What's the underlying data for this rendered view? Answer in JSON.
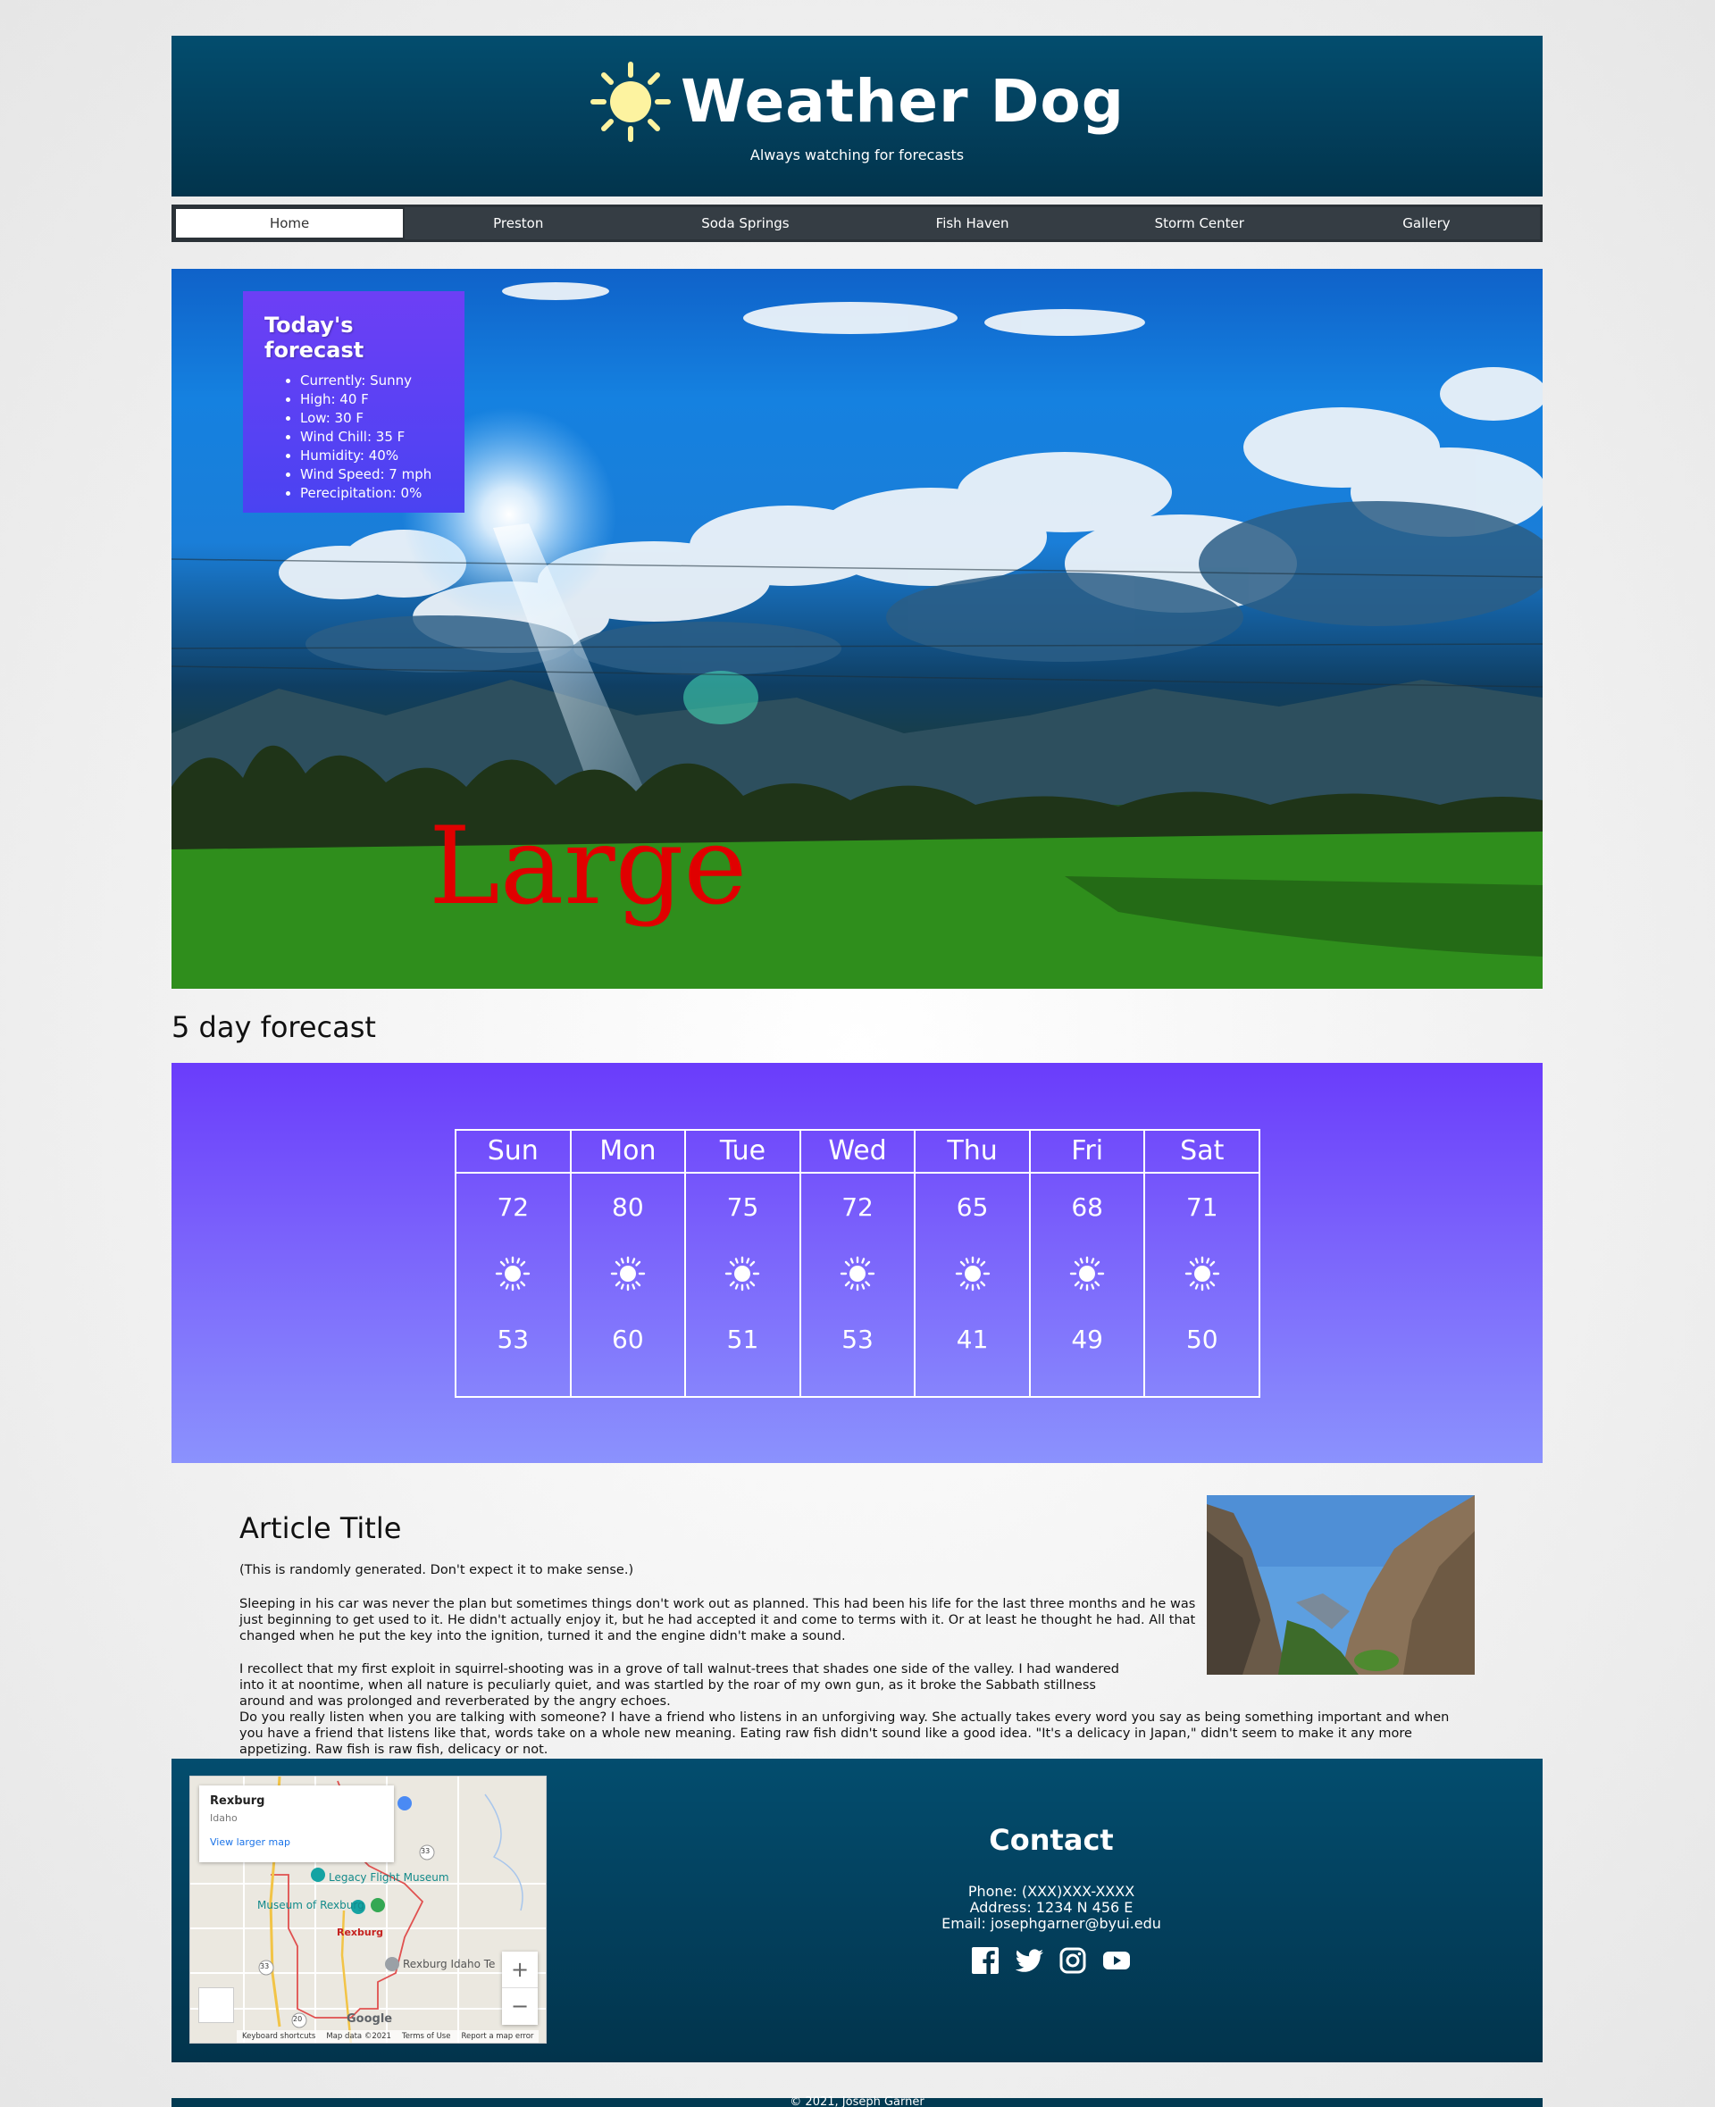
{
  "header": {
    "title": "Weather Dog",
    "tagline": "Always watching for forecasts",
    "logo_icon": "sun-icon"
  },
  "nav": {
    "items": [
      {
        "label": "Home",
        "active": true
      },
      {
        "label": "Preston",
        "active": false
      },
      {
        "label": "Soda Springs",
        "active": false
      },
      {
        "label": "Fish Haven",
        "active": false
      },
      {
        "label": "Storm Center",
        "active": false
      },
      {
        "label": "Gallery",
        "active": false
      }
    ]
  },
  "hero": {
    "overlay_text": "Large",
    "forecast": {
      "title": "Today's forecast",
      "items": [
        "Currently: Sunny",
        "High: 40 F",
        "Low: 30 F",
        "Wind Chill: 35 F",
        "Humidity: 40%",
        "Wind Speed: 7 mph",
        "Perecipitation: 0%"
      ]
    }
  },
  "five_day": {
    "title": "5 day forecast",
    "days": [
      {
        "day": "Sun",
        "high": "72",
        "low": "53",
        "icon": "sun-icon"
      },
      {
        "day": "Mon",
        "high": "80",
        "low": "60",
        "icon": "sun-icon"
      },
      {
        "day": "Tue",
        "high": "75",
        "low": "51",
        "icon": "sun-icon"
      },
      {
        "day": "Wed",
        "high": "72",
        "low": "53",
        "icon": "sun-icon"
      },
      {
        "day": "Thu",
        "high": "65",
        "low": "41",
        "icon": "sun-icon"
      },
      {
        "day": "Fri",
        "high": "68",
        "low": "49",
        "icon": "sun-icon"
      },
      {
        "day": "Sat",
        "high": "71",
        "low": "50",
        "icon": "sun-icon"
      }
    ]
  },
  "article": {
    "title": "Article Title",
    "intro": "(This is randomly generated. Don't expect it to make sense.)",
    "p1": "Sleeping in his car was never the plan but sometimes things don't work out as planned. This had been his life for the last three months and he was just beginning to get used to it. He didn't actually enjoy it, but he had accepted it and come to terms with it. Or at least he thought he had. All that changed when he put the key into the ignition, turned it and the engine didn't make a sound.",
    "p2a": "I recollect that my first exploit in squirrel-shooting was in a grove of tall walnut-trees that shades one side of the valley. I had wandered into it at noontime, when all nature is peculiarly quiet, and was startled by the roar of my own gun, as it broke the Sabbath stillness around and was prolonged and reverberated by the angry echoes.",
    "p2b": "Do you really listen when you are talking with someone? I have a friend who listens in an unforgiving way. She actually takes every word you say as being something important and when you have a friend that listens like that, words take on a whole new meaning. Eating raw fish didn't sound like a good idea. \"It's a delicacy in Japan,\" didn't seem to make it any more appetizing. Raw fish is raw fish, delicacy or not."
  },
  "map": {
    "place": "Rexburg",
    "region": "Idaho",
    "link": "View larger map",
    "labels": [
      "Legacy Flight Museum",
      "Museum of Rexburg",
      "Rexburg",
      "Rexburg Idaho Te"
    ],
    "route_shields": [
      "33",
      "33",
      "20"
    ],
    "zoom_in": "+",
    "zoom_out": "−",
    "brand": "Google",
    "attribution": [
      "Keyboard shortcuts",
      "Map data ©2021",
      "Terms of Use",
      "Report a map error"
    ]
  },
  "contact": {
    "title": "Contact",
    "phone": "Phone: (XXX)XXX-XXXX",
    "address": "Address: 1234 N 456 E",
    "email": "Email: josephgarner@byui.edu",
    "socials": [
      "facebook-icon",
      "twitter-icon",
      "instagram-icon",
      "youtube-icon"
    ]
  },
  "footer": {
    "copyright": "© 2021, Joseph Garner"
  },
  "colors": {
    "header_bg": "#034d6e",
    "nav_bg": "#353d44",
    "forecast_box": "#5a42f3",
    "five_day_top": "#6a3cfb",
    "five_day_bottom": "#8b92fd",
    "overlay_text": "#e00000"
  }
}
